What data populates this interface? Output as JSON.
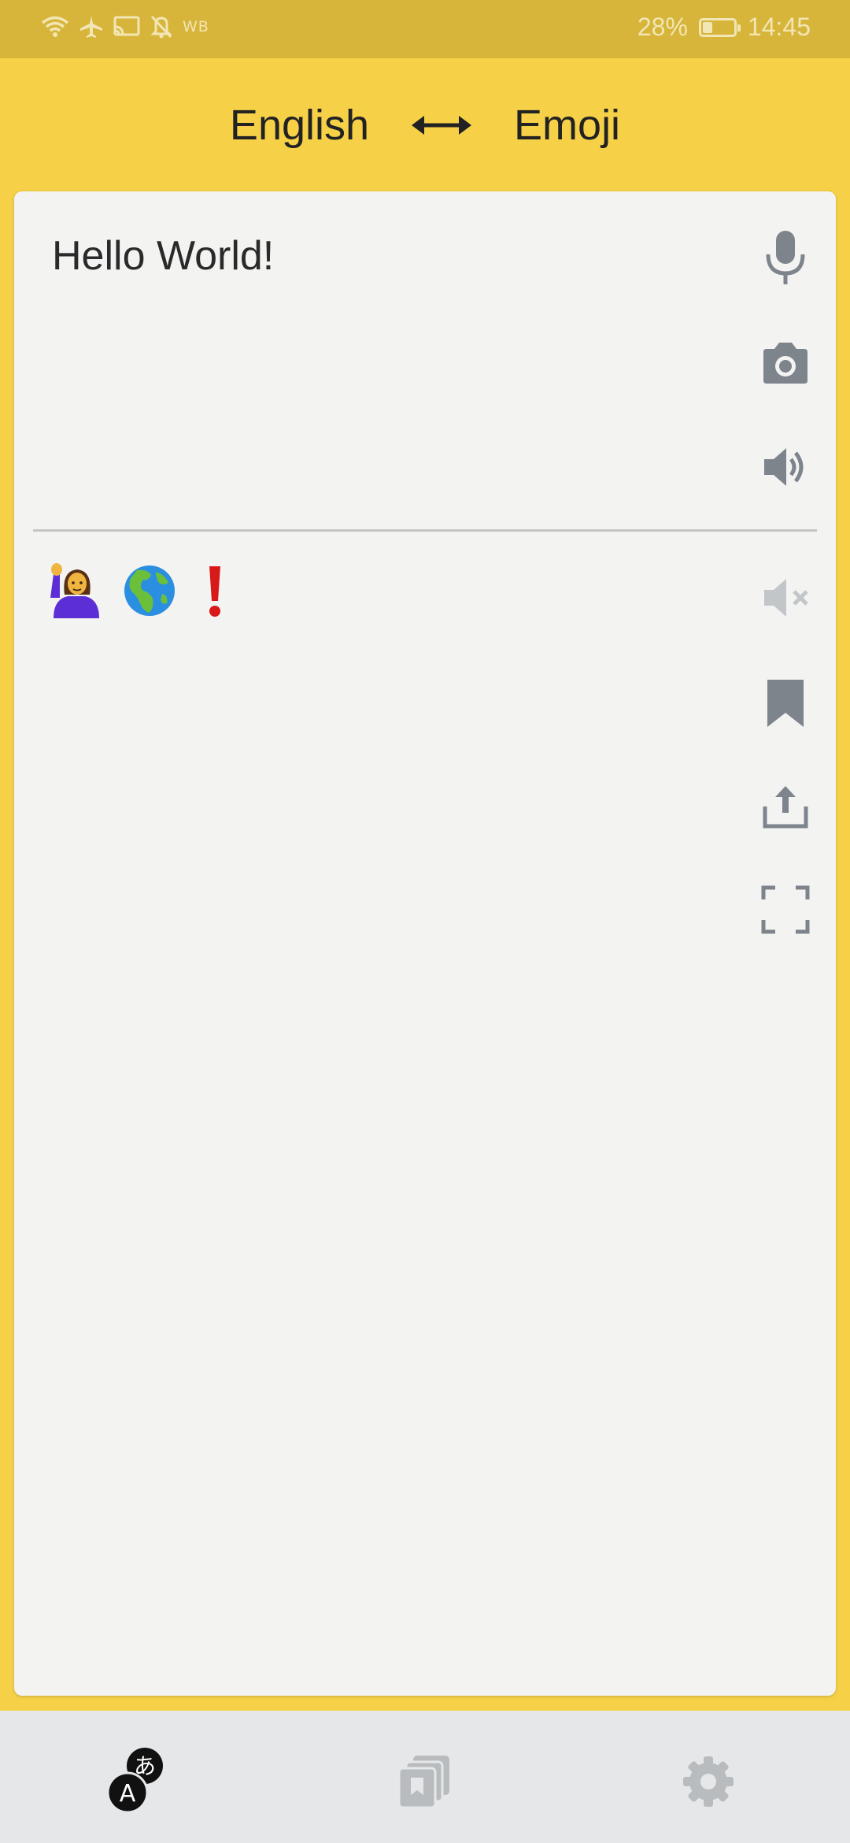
{
  "status_bar": {
    "carrier_label": "WB",
    "battery_percent": "28%",
    "battery_level": 0.28,
    "time": "14:45",
    "icons": [
      "wifi-icon",
      "airplane-icon",
      "cast-icon",
      "bell-off-icon"
    ]
  },
  "header": {
    "source_language": "English",
    "target_language": "Emoji",
    "swap_icon": "swap-arrows-icon"
  },
  "input": {
    "text": "Hello World!"
  },
  "input_actions": [
    "microphone-icon",
    "camera-icon",
    "speaker-icon"
  ],
  "output": {
    "emojis": [
      "woman-raising-hand-emoji",
      "globe-europe-africa-emoji",
      "exclamation-mark-emoji"
    ]
  },
  "output_actions": [
    "speaker-muted-icon",
    "bookmark-icon",
    "share-icon",
    "fullscreen-icon"
  ],
  "bottom_nav": {
    "items": [
      "translate-icon",
      "saved-cards-icon",
      "settings-icon"
    ],
    "active": "translate-icon"
  },
  "colors": {
    "accent": "#f6d148",
    "status_bar": "#d7b53a",
    "card": "#f3f3f2",
    "icon": "#7d848c",
    "icon_disabled": "#c3c6c9",
    "nav_bg": "#e6e7e8"
  }
}
